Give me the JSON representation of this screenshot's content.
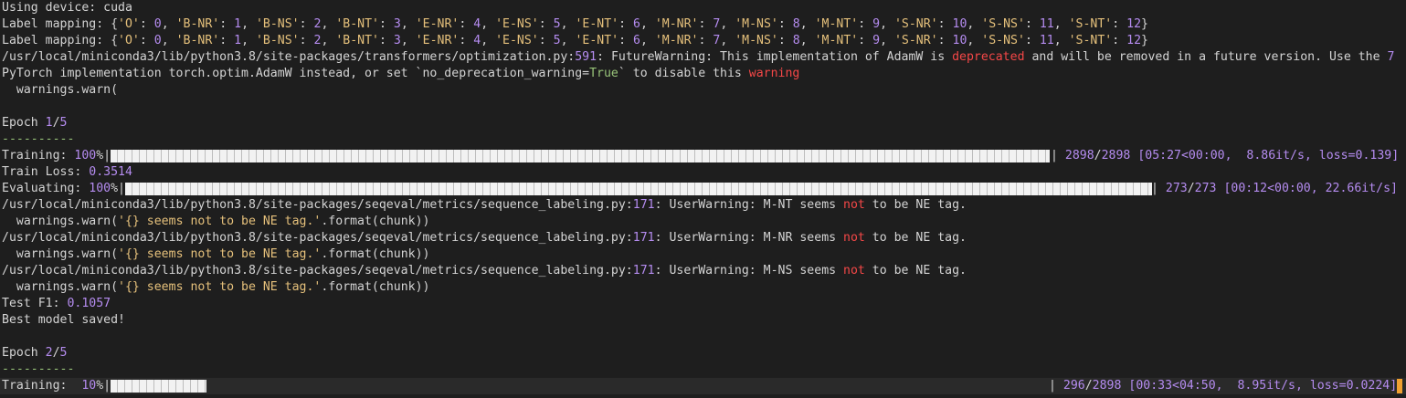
{
  "terminal": {
    "lines": [
      [
        {
          "t": "Using device",
          "c": ""
        },
        {
          "t": ": cuda",
          "c": ""
        }
      ],
      [
        {
          "t": "Label mapping: {",
          "c": ""
        },
        {
          "t": "'O'",
          "c": "str"
        },
        {
          "t": ": ",
          "c": ""
        },
        {
          "t": "0",
          "c": "num"
        },
        {
          "t": ", ",
          "c": ""
        },
        {
          "t": "'B-NR'",
          "c": "str"
        },
        {
          "t": ": ",
          "c": ""
        },
        {
          "t": "1",
          "c": "num"
        },
        {
          "t": ", ",
          "c": ""
        },
        {
          "t": "'B-NS'",
          "c": "str"
        },
        {
          "t": ": ",
          "c": ""
        },
        {
          "t": "2",
          "c": "num"
        },
        {
          "t": ", ",
          "c": ""
        },
        {
          "t": "'B-NT'",
          "c": "str"
        },
        {
          "t": ": ",
          "c": ""
        },
        {
          "t": "3",
          "c": "num"
        },
        {
          "t": ", ",
          "c": ""
        },
        {
          "t": "'E-NR'",
          "c": "str"
        },
        {
          "t": ": ",
          "c": ""
        },
        {
          "t": "4",
          "c": "num"
        },
        {
          "t": ", ",
          "c": ""
        },
        {
          "t": "'E-NS'",
          "c": "str"
        },
        {
          "t": ": ",
          "c": ""
        },
        {
          "t": "5",
          "c": "num"
        },
        {
          "t": ", ",
          "c": ""
        },
        {
          "t": "'E-NT'",
          "c": "str"
        },
        {
          "t": ": ",
          "c": ""
        },
        {
          "t": "6",
          "c": "num"
        },
        {
          "t": ", ",
          "c": ""
        },
        {
          "t": "'M-NR'",
          "c": "str"
        },
        {
          "t": ": ",
          "c": ""
        },
        {
          "t": "7",
          "c": "num"
        },
        {
          "t": ", ",
          "c": ""
        },
        {
          "t": "'M-NS'",
          "c": "str"
        },
        {
          "t": ": ",
          "c": ""
        },
        {
          "t": "8",
          "c": "num"
        },
        {
          "t": ", ",
          "c": ""
        },
        {
          "t": "'M-NT'",
          "c": "str"
        },
        {
          "t": ": ",
          "c": ""
        },
        {
          "t": "9",
          "c": "num"
        },
        {
          "t": ", ",
          "c": ""
        },
        {
          "t": "'S-NR'",
          "c": "str"
        },
        {
          "t": ": ",
          "c": ""
        },
        {
          "t": "10",
          "c": "num"
        },
        {
          "t": ", ",
          "c": ""
        },
        {
          "t": "'S-NS'",
          "c": "str"
        },
        {
          "t": ": ",
          "c": ""
        },
        {
          "t": "11",
          "c": "num"
        },
        {
          "t": ", ",
          "c": ""
        },
        {
          "t": "'S-NT'",
          "c": "str"
        },
        {
          "t": ": ",
          "c": ""
        },
        {
          "t": "12",
          "c": "num"
        },
        {
          "t": "}",
          "c": ""
        }
      ],
      [
        {
          "t": "Label mapping: {",
          "c": ""
        },
        {
          "t": "'O'",
          "c": "str"
        },
        {
          "t": ": ",
          "c": ""
        },
        {
          "t": "0",
          "c": "num"
        },
        {
          "t": ", ",
          "c": ""
        },
        {
          "t": "'B-NR'",
          "c": "str"
        },
        {
          "t": ": ",
          "c": ""
        },
        {
          "t": "1",
          "c": "num"
        },
        {
          "t": ", ",
          "c": ""
        },
        {
          "t": "'B-NS'",
          "c": "str"
        },
        {
          "t": ": ",
          "c": ""
        },
        {
          "t": "2",
          "c": "num"
        },
        {
          "t": ", ",
          "c": ""
        },
        {
          "t": "'B-NT'",
          "c": "str"
        },
        {
          "t": ": ",
          "c": ""
        },
        {
          "t": "3",
          "c": "num"
        },
        {
          "t": ", ",
          "c": ""
        },
        {
          "t": "'E-NR'",
          "c": "str"
        },
        {
          "t": ": ",
          "c": ""
        },
        {
          "t": "4",
          "c": "num"
        },
        {
          "t": ", ",
          "c": ""
        },
        {
          "t": "'E-NS'",
          "c": "str"
        },
        {
          "t": ": ",
          "c": ""
        },
        {
          "t": "5",
          "c": "num"
        },
        {
          "t": ", ",
          "c": ""
        },
        {
          "t": "'E-NT'",
          "c": "str"
        },
        {
          "t": ": ",
          "c": ""
        },
        {
          "t": "6",
          "c": "num"
        },
        {
          "t": ", ",
          "c": ""
        },
        {
          "t": "'M-NR'",
          "c": "str"
        },
        {
          "t": ": ",
          "c": ""
        },
        {
          "t": "7",
          "c": "num"
        },
        {
          "t": ", ",
          "c": ""
        },
        {
          "t": "'M-NS'",
          "c": "str"
        },
        {
          "t": ": ",
          "c": ""
        },
        {
          "t": "8",
          "c": "num"
        },
        {
          "t": ", ",
          "c": ""
        },
        {
          "t": "'M-NT'",
          "c": "str"
        },
        {
          "t": ": ",
          "c": ""
        },
        {
          "t": "9",
          "c": "num"
        },
        {
          "t": ", ",
          "c": ""
        },
        {
          "t": "'S-NR'",
          "c": "str"
        },
        {
          "t": ": ",
          "c": ""
        },
        {
          "t": "10",
          "c": "num"
        },
        {
          "t": ", ",
          "c": ""
        },
        {
          "t": "'S-NS'",
          "c": "str"
        },
        {
          "t": ": ",
          "c": ""
        },
        {
          "t": "11",
          "c": "num"
        },
        {
          "t": ", ",
          "c": ""
        },
        {
          "t": "'S-NT'",
          "c": "str"
        },
        {
          "t": ": ",
          "c": ""
        },
        {
          "t": "12",
          "c": "num"
        },
        {
          "t": "}",
          "c": ""
        }
      ],
      [
        {
          "t": "/usr/local/miniconda3/lib/python3.8/site-packages/transformers/optimization.py:",
          "c": ""
        },
        {
          "t": "591",
          "c": "num"
        },
        {
          "t": ": FutureWarning: This implementation of AdamW is ",
          "c": ""
        },
        {
          "t": "deprecated",
          "c": "red"
        },
        {
          "t": " and will be removed in a future version. Use the ",
          "c": ""
        },
        {
          "t": "7",
          "c": "num"
        }
      ],
      [
        {
          "t": "PyTorch implementation torch.optim.AdamW instead, or set `no_deprecation_warning=",
          "c": ""
        },
        {
          "t": "True",
          "c": "grn"
        },
        {
          "t": "` to disable this ",
          "c": ""
        },
        {
          "t": "warning",
          "c": "red"
        }
      ],
      [
        {
          "t": "  warnings.warn(",
          "c": ""
        }
      ],
      [],
      [
        {
          "t": "Epoch ",
          "c": ""
        },
        {
          "t": "1",
          "c": "num"
        },
        {
          "t": "/",
          "c": ""
        },
        {
          "t": "5",
          "c": "num"
        }
      ],
      [
        {
          "t": "----------",
          "c": "grn"
        }
      ],
      {
        "type": "progress",
        "name": "training-progress-epoch1",
        "label": "Training: ",
        "percent_text": "100",
        "bar_fill": 1.0,
        "counts": "2898/2898",
        "stats": " [05:27<00:00,  8.86it/s, loss=0.139]"
      },
      [
        {
          "t": "Train Loss: ",
          "c": ""
        },
        {
          "t": "0.3514",
          "c": "num"
        }
      ],
      {
        "type": "progress",
        "name": "evaluating-progress-epoch1",
        "label": "Evaluating: ",
        "percent_text": "100",
        "bar_fill": 1.0,
        "counts": "273/273",
        "stats": " [00:12<00:00, 22.66it/s]"
      },
      [
        {
          "t": "/usr/local/miniconda3/lib/python3.8/site-packages/seqeval/metrics/sequence_labeling.py:",
          "c": ""
        },
        {
          "t": "171",
          "c": "num"
        },
        {
          "t": ": UserWarning: M-NT seems ",
          "c": ""
        },
        {
          "t": "not",
          "c": "red"
        },
        {
          "t": " to be NE tag.",
          "c": ""
        }
      ],
      [
        {
          "t": "  warnings.warn(",
          "c": ""
        },
        {
          "t": "'{} seems not to be NE tag.'",
          "c": "str"
        },
        {
          "t": ".format(chunk))",
          "c": ""
        }
      ],
      [
        {
          "t": "/usr/local/miniconda3/lib/python3.8/site-packages/seqeval/metrics/sequence_labeling.py:",
          "c": ""
        },
        {
          "t": "171",
          "c": "num"
        },
        {
          "t": ": UserWarning: M-NR seems ",
          "c": ""
        },
        {
          "t": "not",
          "c": "red"
        },
        {
          "t": " to be NE tag.",
          "c": ""
        }
      ],
      [
        {
          "t": "  warnings.warn(",
          "c": ""
        },
        {
          "t": "'{} seems not to be NE tag.'",
          "c": "str"
        },
        {
          "t": ".format(chunk))",
          "c": ""
        }
      ],
      [
        {
          "t": "/usr/local/miniconda3/lib/python3.8/site-packages/seqeval/metrics/sequence_labeling.py:",
          "c": ""
        },
        {
          "t": "171",
          "c": "num"
        },
        {
          "t": ": UserWarning: M-NS seems ",
          "c": ""
        },
        {
          "t": "not",
          "c": "red"
        },
        {
          "t": " to be NE tag.",
          "c": ""
        }
      ],
      [
        {
          "t": "  warnings.warn(",
          "c": ""
        },
        {
          "t": "'{} seems not to be NE tag.'",
          "c": "str"
        },
        {
          "t": ".format(chunk))",
          "c": ""
        }
      ],
      [
        {
          "t": "Test F1: ",
          "c": ""
        },
        {
          "t": "0.1057",
          "c": "num"
        }
      ],
      [
        {
          "t": "Best model saved!",
          "c": ""
        }
      ],
      [],
      [
        {
          "t": "Epoch ",
          "c": ""
        },
        {
          "t": "2",
          "c": "num"
        },
        {
          "t": "/",
          "c": ""
        },
        {
          "t": "5",
          "c": "num"
        }
      ],
      [
        {
          "t": "----------",
          "c": "grn"
        }
      ],
      {
        "type": "progress",
        "name": "training-progress-epoch2",
        "active": true,
        "label": "Training:  ",
        "percent_text": "10",
        "bar_fill": 0.102,
        "counts": "296/2898",
        "stats": " [00:33<04:50,  8.95it/s, loss=0.0224]"
      }
    ]
  },
  "colors": {
    "background": "#1e1e1e",
    "text": "#d4d4d4",
    "number": "#b58cf0",
    "string": "#e5c07b",
    "error": "#f44747",
    "green": "#98c379",
    "cursor": "#f0a030"
  }
}
